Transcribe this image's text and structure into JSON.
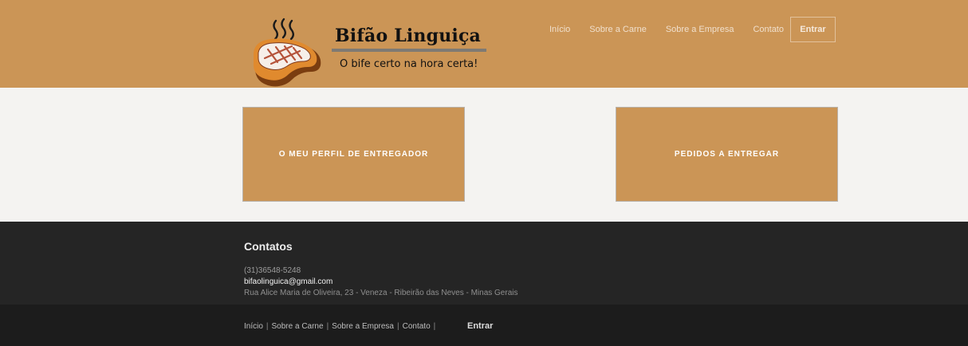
{
  "header": {
    "brand": {
      "title": "Bifão Linguiça",
      "tagline": "O bife certo na hora certa!",
      "logo_icon": "steak-icon"
    },
    "nav": [
      "Início",
      "Sobre a Carne",
      "Sobre a Empresa",
      "Contato"
    ],
    "login_label": "Entrar"
  },
  "main": {
    "cards": [
      "O MEU PERFIL DE ENTREGADOR",
      "PEDIDOS A ENTREGAR"
    ]
  },
  "footer": {
    "title": "Contatos",
    "phone": "(31)36548-5248",
    "email": "bifaolinguica@gmail.com",
    "address": "Rua Alice Maria de Oliveira, 23 - Veneza - Ribeirão das Neves - Minas Gerais",
    "nav": [
      "Início",
      "Sobre a Carne",
      "Sobre a Empresa",
      "Contato"
    ],
    "login_label": "Entrar"
  },
  "colors": {
    "header_bg": "#cb9556",
    "page_bg": "#f4f3f1",
    "footer_top_bg": "#252525",
    "footer_bottom_bg": "#1c1c1c"
  }
}
